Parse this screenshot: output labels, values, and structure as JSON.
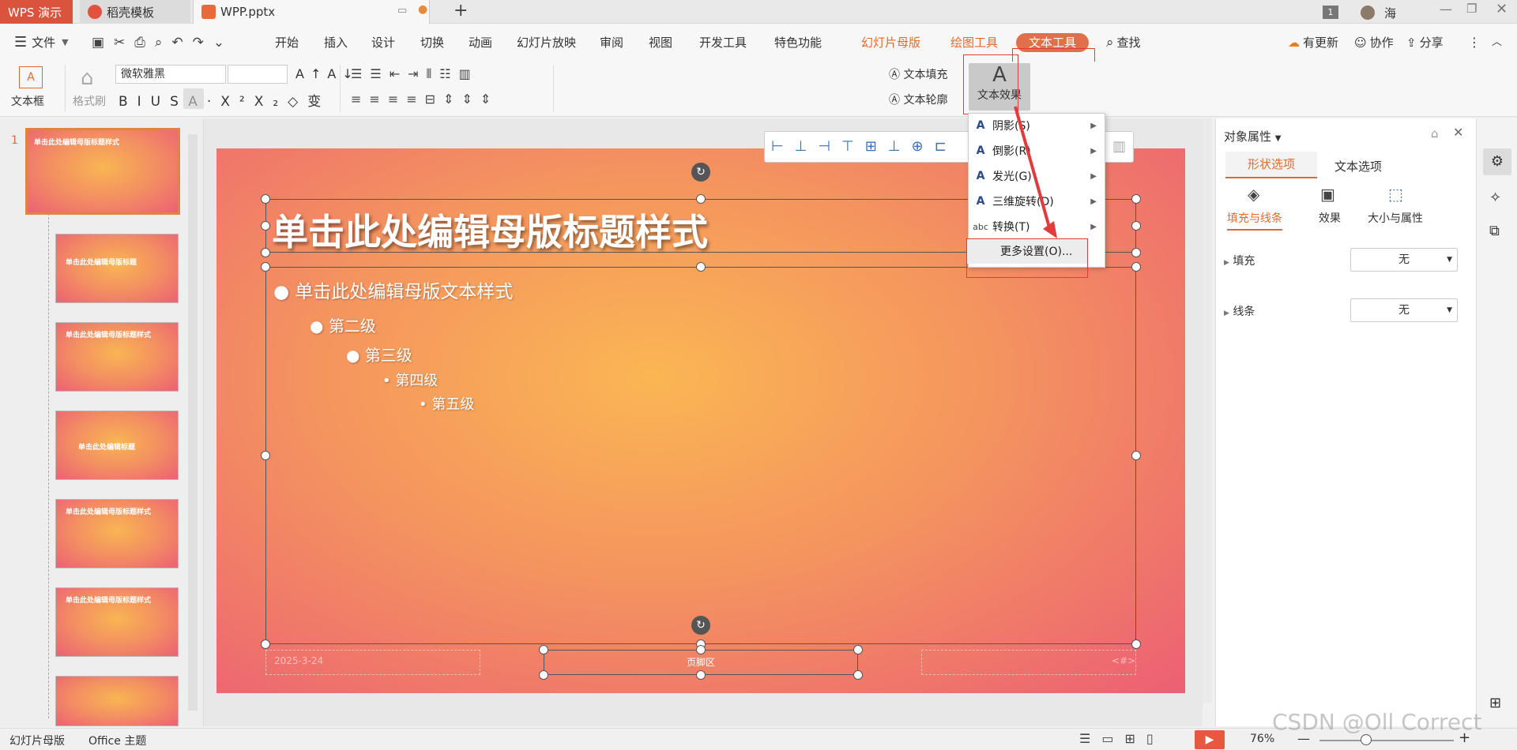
{
  "titlebar": {
    "app_tab": "WPS 演示",
    "template_tab": "稻壳模板",
    "doc_tab": "WPP.pptx",
    "new_tab": "+",
    "badge": "1",
    "user": "海"
  },
  "menubar": {
    "file": "文件",
    "items": [
      "开始",
      "插入",
      "设计",
      "切换",
      "动画",
      "幻灯片放映",
      "审阅",
      "视图",
      "开发工具",
      "特色功能"
    ],
    "master": "幻灯片母版",
    "draw_tools": "绘图工具",
    "text_tools": "文本工具",
    "search": "查找",
    "update": "有更新",
    "collab": "协作",
    "share": "分享"
  },
  "ribbon": {
    "textbox": "文本框",
    "format_painter": "格式刷",
    "font": "微软雅黑",
    "font_size": "",
    "text_fill": "文本填充",
    "text_outline": "文本轮廓",
    "text_effect": "文本效果",
    "gallery": [
      {
        "letter": "A",
        "color": "#111111"
      },
      {
        "letter": "A",
        "color": "#3b78d8"
      },
      {
        "letter": "A",
        "color": "#5fb6e6"
      },
      {
        "letter": "A",
        "color": "#f4d4d4"
      },
      {
        "letter": "A",
        "color": "#f3b33d"
      },
      {
        "letter": "A",
        "color": "#555555"
      }
    ]
  },
  "dropdown": {
    "items": [
      {
        "icon": "A",
        "label": "阴影(S)"
      },
      {
        "icon": "A",
        "label": "倒影(R)"
      },
      {
        "icon": "A",
        "label": "发光(G)"
      },
      {
        "icon": "A",
        "label": "三维旋转(D)"
      },
      {
        "icon": "abc",
        "label": "转换(T)"
      }
    ],
    "more": "更多设置(O)..."
  },
  "slide": {
    "title": "单击此处编辑母版标题样式",
    "level1": "单击此处编辑母版文本样式",
    "level2": "第二级",
    "level3": "第三级",
    "level4": "第四级",
    "level5": "第五级",
    "date": "2025-3-24",
    "footer": "页脚区",
    "page": "<#>"
  },
  "thumbnails": [
    {
      "title": "单击此处编辑母版标题样式"
    },
    {
      "title": "单击此处编辑母版标题"
    },
    {
      "title": "单击此处编辑母版标题样式"
    },
    {
      "title": "单击此处编辑标题"
    },
    {
      "title": "单击此处编辑母版标题样式"
    },
    {
      "title": "单击此处编辑母版标题样式"
    }
  ],
  "slide_number": "1",
  "panel": {
    "title": "对象属性",
    "tab_shape": "形状选项",
    "tab_text": "文本选项",
    "sub_fill": "填充与线条",
    "sub_effect": "效果",
    "sub_size": "大小与属性",
    "fill_label": "填充",
    "fill_value": "无",
    "line_label": "线条",
    "line_value": "无"
  },
  "status": {
    "mode": "幻灯片母版",
    "theme": "Office 主题",
    "zoom": "76%"
  },
  "watermark": "CSDN @Oll Correct"
}
